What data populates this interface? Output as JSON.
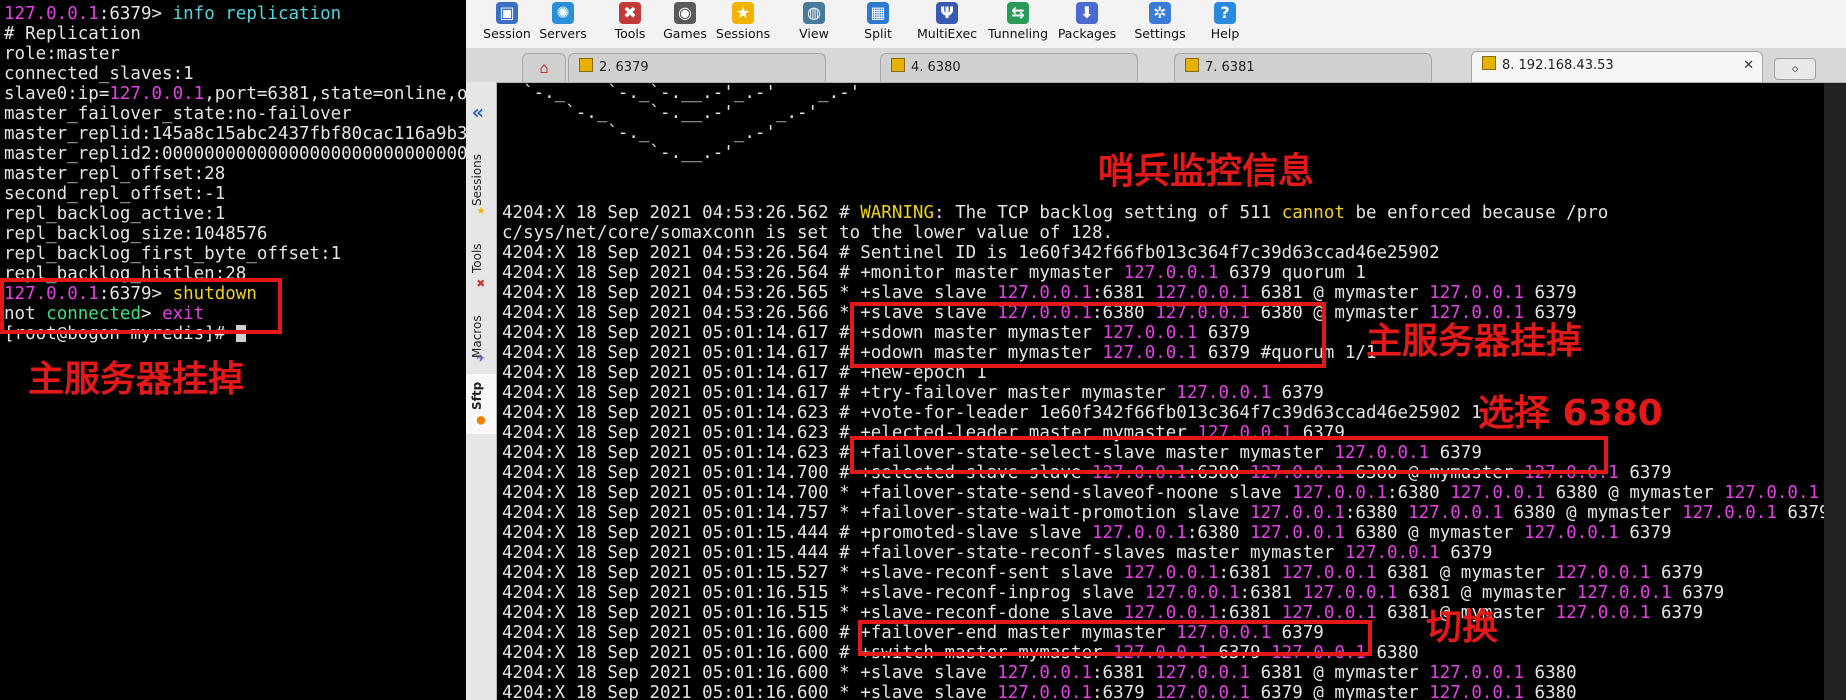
{
  "left_terminal": {
    "lines": [
      [
        {
          "t": "127.0.0.1",
          "c": "mag"
        },
        {
          "t": ":6379> ",
          "c": "wht"
        },
        {
          "t": "info replication",
          "c": "cyan"
        }
      ],
      [
        {
          "t": "# Replication",
          "c": "wht"
        }
      ],
      [
        {
          "t": "role:master",
          "c": "wht"
        }
      ],
      [
        {
          "t": "connected_slaves:1",
          "c": "wht"
        }
      ],
      [
        {
          "t": "slave0:ip=",
          "c": "wht"
        },
        {
          "t": "127.0.0.1",
          "c": "mag"
        },
        {
          "t": ",port=6381,state=online,off",
          "c": "wht"
        }
      ],
      [
        {
          "t": "master_failover_state:no-failover",
          "c": "wht"
        }
      ],
      [
        {
          "t": "master_replid:145a8c15abc2437fbf80cac116a9b3b9",
          "c": "wht"
        }
      ],
      [
        {
          "t": "master_replid2:00000000000000000000000000000000",
          "c": "wht"
        }
      ],
      [
        {
          "t": "master_repl_offset:28",
          "c": "wht"
        }
      ],
      [
        {
          "t": "second_repl_offset:-1",
          "c": "wht"
        }
      ],
      [
        {
          "t": "repl_backlog_active:1",
          "c": "wht"
        }
      ],
      [
        {
          "t": "repl_backlog_size:1048576",
          "c": "wht"
        }
      ],
      [
        {
          "t": "repl_backlog_first_byte_offset:1",
          "c": "wht"
        }
      ],
      [
        {
          "t": "repl_backlog_histlen:28",
          "c": "wht"
        }
      ],
      [
        {
          "t": "127.0.0.1",
          "c": "mag"
        },
        {
          "t": ":6379> ",
          "c": "wht"
        },
        {
          "t": "shutdown",
          "c": "yel"
        }
      ],
      [
        {
          "t": "not ",
          "c": "wht"
        },
        {
          "t": "connected",
          "c": "grn"
        },
        {
          "t": "> ",
          "c": "wht"
        },
        {
          "t": "exit",
          "c": "mag"
        }
      ],
      [
        {
          "t": "[root@bogon myredis]# ",
          "c": "wht"
        }
      ]
    ],
    "annotation": "主服务器挂掉"
  },
  "toolbar": {
    "items": [
      {
        "label": "Session",
        "icon": "session-icon",
        "glyph": "▣",
        "color": "#3a6fc4"
      },
      {
        "label": "Servers",
        "icon": "servers-icon",
        "glyph": "✺",
        "color": "#2a8fd8"
      },
      {
        "label": "Tools",
        "icon": "tools-icon",
        "glyph": "✖",
        "color": "#c43a3a"
      },
      {
        "label": "Games",
        "icon": "games-icon",
        "glyph": "◉",
        "color": "#5a5a5a"
      },
      {
        "label": "Sessions",
        "icon": "sessions-star-icon",
        "glyph": "★",
        "color": "#f0b400"
      },
      {
        "label": "View",
        "icon": "view-icon",
        "glyph": "◍",
        "color": "#4a7a9a"
      },
      {
        "label": "Split",
        "icon": "split-icon",
        "glyph": "▦",
        "color": "#2a7ad0"
      },
      {
        "label": "MultiExec",
        "icon": "multiexec-icon",
        "glyph": "Ψ",
        "color": "#3a5ab0"
      },
      {
        "label": "Tunneling",
        "icon": "tunneling-icon",
        "glyph": "⇆",
        "color": "#2a9a5a"
      },
      {
        "label": "Packages",
        "icon": "packages-icon",
        "glyph": "⬇",
        "color": "#4a6ad0"
      },
      {
        "label": "Settings",
        "icon": "settings-gear-icon",
        "glyph": "✲",
        "color": "#3a7ad8"
      },
      {
        "label": "Help",
        "icon": "help-icon",
        "glyph": "?",
        "color": "#2a8ae0"
      }
    ]
  },
  "tabs": [
    {
      "label": "2. 6379",
      "active": false
    },
    {
      "label": "4. 6380",
      "active": false
    },
    {
      "label": "7. 6381",
      "active": false
    },
    {
      "label": "8. 192.168.43.53",
      "active": true
    }
  ],
  "sidebar": {
    "items": [
      "Sessions",
      "Tools",
      "Macros",
      "Sftp"
    ]
  },
  "terminal": {
    "lines": [
      [
        {
          "t": "  `-._    `-._`-.__.-'_.-'    _.-'",
          "c": "wht"
        }
      ],
      [
        {
          "t": "      `-._    `-.__.-'    _.-'",
          "c": "wht"
        }
      ],
      [
        {
          "t": "          `-._        _.-'",
          "c": "wht"
        }
      ],
      [
        {
          "t": "              `-.__.-'",
          "c": "wht"
        }
      ],
      [
        {
          "t": "",
          "c": "wht"
        }
      ],
      [
        {
          "t": "",
          "c": "wht"
        }
      ],
      [
        {
          "t": "4204:X 18 Sep 2021 04:53:26.562 # ",
          "c": "wht"
        },
        {
          "t": "WARNING",
          "c": "yel"
        },
        {
          "t": ": The TCP backlog setting of 511 ",
          "c": "wht"
        },
        {
          "t": "cannot",
          "c": "yel"
        },
        {
          "t": " be enforced because /pro",
          "c": "wht"
        }
      ],
      [
        {
          "t": "c/sys/net/core/somaxconn is set to the lower value of 128.",
          "c": "wht"
        }
      ],
      [
        {
          "t": "4204:X 18 Sep 2021 04:53:26.564 # Sentinel ID is 1e60f342f66fb013c364f7c39d63ccad46e25902",
          "c": "wht"
        }
      ],
      [
        {
          "t": "4204:X 18 Sep 2021 04:53:26.564 # +monitor master mymaster ",
          "c": "wht"
        },
        {
          "t": "127.0.0.1",
          "c": "mag"
        },
        {
          "t": " 6379 quorum 1",
          "c": "wht"
        }
      ],
      [
        {
          "t": "4204:X 18 Sep 2021 04:53:26.565 * +slave slave ",
          "c": "wht"
        },
        {
          "t": "127.0.0.1",
          "c": "mag"
        },
        {
          "t": ":6381 ",
          "c": "wht"
        },
        {
          "t": "127.0.0.1",
          "c": "mag"
        },
        {
          "t": " 6381 @ mymaster ",
          "c": "wht"
        },
        {
          "t": "127.0.0.1",
          "c": "mag"
        },
        {
          "t": " 6379",
          "c": "wht"
        }
      ],
      [
        {
          "t": "4204:X 18 Sep 2021 04:53:26.566 * +slave slave ",
          "c": "wht"
        },
        {
          "t": "127.0.0.1",
          "c": "mag"
        },
        {
          "t": ":6380 ",
          "c": "wht"
        },
        {
          "t": "127.0.0.1",
          "c": "mag"
        },
        {
          "t": " 6380 @ mymaster ",
          "c": "wht"
        },
        {
          "t": "127.0.0.1",
          "c": "mag"
        },
        {
          "t": " 6379",
          "c": "wht"
        }
      ],
      [
        {
          "t": "4204:X 18 Sep 2021 05:01:14.617 # +sdown master mymaster ",
          "c": "wht"
        },
        {
          "t": "127.0.0.1",
          "c": "mag"
        },
        {
          "t": " 6379",
          "c": "wht"
        }
      ],
      [
        {
          "t": "4204:X 18 Sep 2021 05:01:14.617 # +odown master mymaster ",
          "c": "wht"
        },
        {
          "t": "127.0.0.1",
          "c": "mag"
        },
        {
          "t": " 6379 #quorum 1/1",
          "c": "wht"
        }
      ],
      [
        {
          "t": "4204:X 18 Sep 2021 05:01:14.617 # +new-epoch 1",
          "c": "wht"
        }
      ],
      [
        {
          "t": "4204:X 18 Sep 2021 05:01:14.617 # +try-failover master mymaster ",
          "c": "wht"
        },
        {
          "t": "127.0.0.1",
          "c": "mag"
        },
        {
          "t": " 6379",
          "c": "wht"
        }
      ],
      [
        {
          "t": "4204:X 18 Sep 2021 05:01:14.623 # +vote-for-leader 1e60f342f66fb013c364f7c39d63ccad46e25902 1",
          "c": "wht"
        }
      ],
      [
        {
          "t": "4204:X 18 Sep 2021 05:01:14.623 # +elected-leader master mymaster ",
          "c": "wht"
        },
        {
          "t": "127.0.0.1",
          "c": "mag"
        },
        {
          "t": " 6379",
          "c": "wht"
        }
      ],
      [
        {
          "t": "4204:X 18 Sep 2021 05:01:14.623 # +failover-state-select-slave master mymaster ",
          "c": "wht"
        },
        {
          "t": "127.0.0.1",
          "c": "mag"
        },
        {
          "t": " 6379",
          "c": "wht"
        }
      ],
      [
        {
          "t": "4204:X 18 Sep 2021 05:01:14.700 # +selected-slave slave ",
          "c": "wht"
        },
        {
          "t": "127.0.0.1",
          "c": "mag"
        },
        {
          "t": ":6380 ",
          "c": "wht"
        },
        {
          "t": "127.0.0.1",
          "c": "mag"
        },
        {
          "t": " 6380 @ mymaster ",
          "c": "wht"
        },
        {
          "t": "127.0.0.1",
          "c": "mag"
        },
        {
          "t": " 6379",
          "c": "wht"
        }
      ],
      [
        {
          "t": "4204:X 18 Sep 2021 05:01:14.700 * +failover-state-send-slaveof-noone slave ",
          "c": "wht"
        },
        {
          "t": "127.0.0.1",
          "c": "mag"
        },
        {
          "t": ":6380 ",
          "c": "wht"
        },
        {
          "t": "127.0.0.1",
          "c": "mag"
        },
        {
          "t": " 6380 @ mymaster ",
          "c": "wht"
        },
        {
          "t": "127.0.0.1",
          "c": "mag"
        },
        {
          "t": " 6379",
          "c": "wht"
        }
      ],
      [
        {
          "t": "4204:X 18 Sep 2021 05:01:14.757 * +failover-state-wait-promotion slave ",
          "c": "wht"
        },
        {
          "t": "127.0.0.1",
          "c": "mag"
        },
        {
          "t": ":6380 ",
          "c": "wht"
        },
        {
          "t": "127.0.0.1",
          "c": "mag"
        },
        {
          "t": " 6380 @ mymaster ",
          "c": "wht"
        },
        {
          "t": "127.0.0.1",
          "c": "mag"
        },
        {
          "t": " 6379",
          "c": "wht"
        }
      ],
      [
        {
          "t": "4204:X 18 Sep 2021 05:01:15.444 # +promoted-slave slave ",
          "c": "wht"
        },
        {
          "t": "127.0.0.1",
          "c": "mag"
        },
        {
          "t": ":6380 ",
          "c": "wht"
        },
        {
          "t": "127.0.0.1",
          "c": "mag"
        },
        {
          "t": " 6380 @ mymaster ",
          "c": "wht"
        },
        {
          "t": "127.0.0.1",
          "c": "mag"
        },
        {
          "t": " 6379",
          "c": "wht"
        }
      ],
      [
        {
          "t": "4204:X 18 Sep 2021 05:01:15.444 # +failover-state-reconf-slaves master mymaster ",
          "c": "wht"
        },
        {
          "t": "127.0.0.1",
          "c": "mag"
        },
        {
          "t": " 6379",
          "c": "wht"
        }
      ],
      [
        {
          "t": "4204:X 18 Sep 2021 05:01:15.527 * +slave-reconf-sent slave ",
          "c": "wht"
        },
        {
          "t": "127.0.0.1",
          "c": "mag"
        },
        {
          "t": ":6381 ",
          "c": "wht"
        },
        {
          "t": "127.0.0.1",
          "c": "mag"
        },
        {
          "t": " 6381 @ mymaster ",
          "c": "wht"
        },
        {
          "t": "127.0.0.1",
          "c": "mag"
        },
        {
          "t": " 6379",
          "c": "wht"
        }
      ],
      [
        {
          "t": "4204:X 18 Sep 2021 05:01:16.515 * +slave-reconf-inprog slave ",
          "c": "wht"
        },
        {
          "t": "127.0.0.1",
          "c": "mag"
        },
        {
          "t": ":6381 ",
          "c": "wht"
        },
        {
          "t": "127.0.0.1",
          "c": "mag"
        },
        {
          "t": " 6381 @ mymaster ",
          "c": "wht"
        },
        {
          "t": "127.0.0.1",
          "c": "mag"
        },
        {
          "t": " 6379",
          "c": "wht"
        }
      ],
      [
        {
          "t": "4204:X 18 Sep 2021 05:01:16.515 * +slave-reconf-done slave ",
          "c": "wht"
        },
        {
          "t": "127.0.0.1",
          "c": "mag"
        },
        {
          "t": ":6381 ",
          "c": "wht"
        },
        {
          "t": "127.0.0.1",
          "c": "mag"
        },
        {
          "t": " 6381 @ mymaster ",
          "c": "wht"
        },
        {
          "t": "127.0.0.1",
          "c": "mag"
        },
        {
          "t": " 6379",
          "c": "wht"
        }
      ],
      [
        {
          "t": "4204:X 18 Sep 2021 05:01:16.600 # +failover-end master mymaster ",
          "c": "wht"
        },
        {
          "t": "127.0.0.1",
          "c": "mag"
        },
        {
          "t": " 6379",
          "c": "wht"
        }
      ],
      [
        {
          "t": "4204:X 18 Sep 2021 05:01:16.600 # +switch-master mymaster ",
          "c": "wht"
        },
        {
          "t": "127.0.0.1",
          "c": "mag"
        },
        {
          "t": " 6379 ",
          "c": "wht"
        },
        {
          "t": "127.0.0.1",
          "c": "mag"
        },
        {
          "t": " 6380",
          "c": "wht"
        }
      ],
      [
        {
          "t": "4204:X 18 Sep 2021 05:01:16.600 * +slave slave ",
          "c": "wht"
        },
        {
          "t": "127.0.0.1",
          "c": "mag"
        },
        {
          "t": ":6381 ",
          "c": "wht"
        },
        {
          "t": "127.0.0.1",
          "c": "mag"
        },
        {
          "t": " 6381 @ mymaster ",
          "c": "wht"
        },
        {
          "t": "127.0.0.1",
          "c": "mag"
        },
        {
          "t": " 6380",
          "c": "wht"
        }
      ],
      [
        {
          "t": "4204:X 18 Sep 2021 05:01:16.600 * +slave slave ",
          "c": "wht"
        },
        {
          "t": "127.0.0.1",
          "c": "mag"
        },
        {
          "t": ":6379 ",
          "c": "wht"
        },
        {
          "t": "127.0.0.1",
          "c": "mag"
        },
        {
          "t": " 6379 @ mymaster ",
          "c": "wht"
        },
        {
          "t": "127.0.0.1",
          "c": "mag"
        },
        {
          "t": " 6380",
          "c": "wht"
        }
      ]
    ]
  },
  "annotations": {
    "sentinel_info": "哨兵监控信息",
    "master_down": "主服务器挂掉",
    "select_6380": "选择 6380",
    "switch": "切换"
  },
  "colors": {
    "annotation_red": "#e31818",
    "ip_magenta": "#e440e4",
    "cmd_cyan": "#4fd6e0"
  }
}
